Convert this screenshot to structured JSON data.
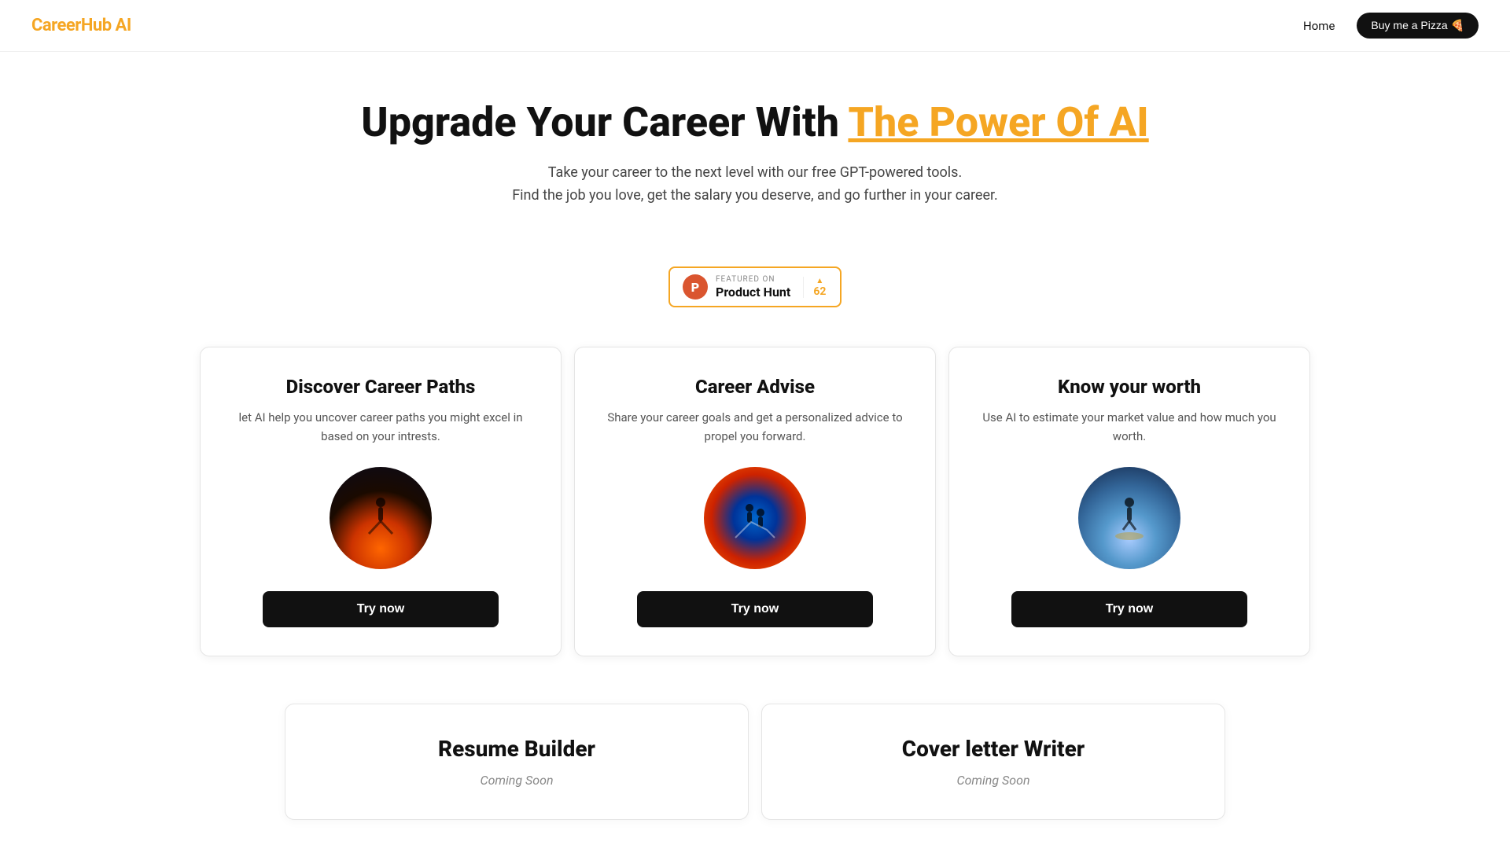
{
  "nav": {
    "logo_text": "CareerHub",
    "logo_highlight": "AI",
    "home_label": "Home",
    "pizza_btn_label": "Buy me a Pizza 🍕"
  },
  "hero": {
    "title_prefix": "Upgrade Your Career With",
    "title_highlight": "The Power Of AI",
    "subtitle_line1": "Take your career to the next level with our free GPT-powered tools.",
    "subtitle_line2": "Find the job you love, get the salary you deserve, and go further in your career."
  },
  "product_hunt": {
    "featured_label": "FEATURED ON",
    "name": "Product Hunt",
    "votes": "62",
    "p_letter": "P"
  },
  "cards": [
    {
      "title": "Discover Career Paths",
      "description": "let AI help you uncover career paths you might excel in based on your intrests.",
      "btn_label": "Try now",
      "image_type": "paths"
    },
    {
      "title": "Career Advise",
      "description": "Share your career goals and get a personalized advice to propel you forward.",
      "btn_label": "Try now",
      "image_type": "advise"
    },
    {
      "title": "Know your worth",
      "description": "Use AI to estimate your market value and how much you worth.",
      "btn_label": "Try now",
      "image_type": "worth"
    }
  ],
  "bottom_cards": [
    {
      "title": "Resume Builder",
      "status": "Coming Soon"
    },
    {
      "title": "Cover letter Writer",
      "status": "Coming Soon"
    }
  ]
}
